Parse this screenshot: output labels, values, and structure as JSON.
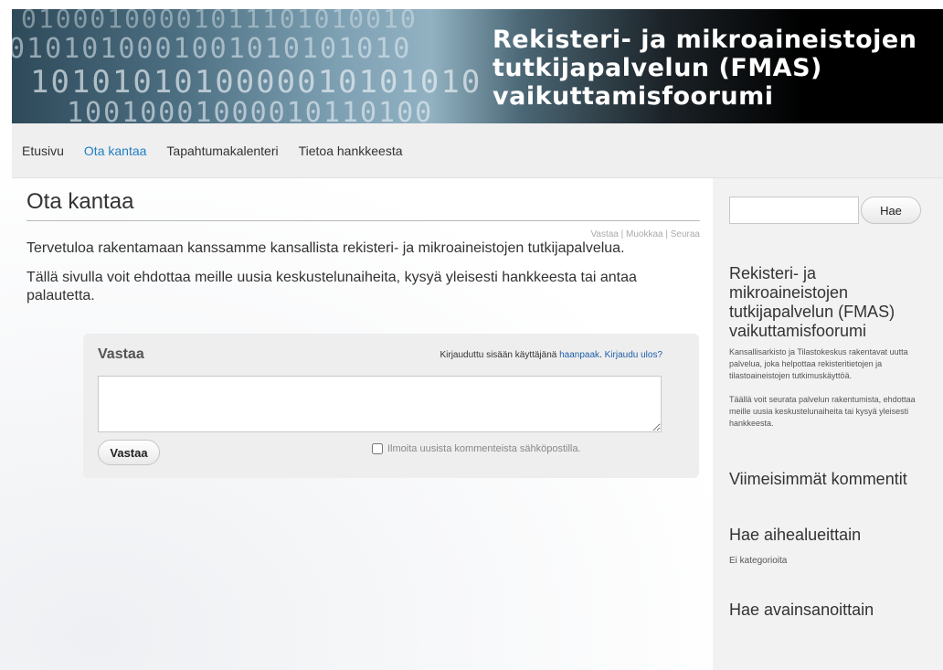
{
  "header": {
    "title_lines": [
      "Rekisteri- ja mikroaineistojen",
      "tutkijapalvelun (FMAS)",
      "vaikuttamisfoorumi"
    ],
    "binary_rows": [
      "01000100001011101010010",
      "0101010001001010101010",
      "1010101010000010101010",
      "10010001000010110100"
    ]
  },
  "nav": {
    "items": [
      {
        "label": "Etusivu"
      },
      {
        "label": "Ota kantaa"
      },
      {
        "label": "Tapahtumakalenteri"
      },
      {
        "label": "Tietoa hankkeesta"
      }
    ],
    "active_color": "#1f7fc4"
  },
  "main": {
    "page_title": "Ota kantaa",
    "post_actions": {
      "reply": "Vastaa",
      "edit": "Muokkaa",
      "follow": "Seuraa",
      "separator": " | "
    },
    "paragraph1": "Tervetuloa rakentamaan kanssamme kansallista rekisteri- ja mikroaineistojen tutkijapalvelua.",
    "paragraph2": "Tällä sivulla voit ehdottaa meille uusia keskustelunaiheita, kysyä yleisesti hankkeesta tai antaa palautetta."
  },
  "reply": {
    "heading": "Vastaa",
    "login_prefix": "Kirjauduttu sisään käyttäjänä ",
    "username": "haanpaak",
    "logout": "Kirjaudu ulos?",
    "textarea_value": "",
    "button_label": "Vastaa",
    "notify_label": "Ilmoita uusista kommenteista sähköpostilla."
  },
  "sidebar": {
    "search_value": "",
    "search_button": "Hae",
    "about_title": "Rekisteri- ja mikroaineistojen tutkijapalvelun (FMAS) vaikuttamisfoorumi",
    "about_text1": "Kansallisarkisto ja Tilastokeskus rakentavat uutta palvelua, joka helpottaa rekisteritietojen ja tilastoaineistojen tutkimuskäyttöä.",
    "about_text2": "Täällä voit seurata palvelun rakentumista, ehdottaa meille uusia keskustelunaiheita tai kysyä yleisesti hankkeesta.",
    "recent_comments_title": "Viimeisimmät kommentit",
    "categories_title": "Hae aihealueittain",
    "categories_empty": "Ei kategorioita",
    "tags_title": "Hae avainsanoittain"
  }
}
